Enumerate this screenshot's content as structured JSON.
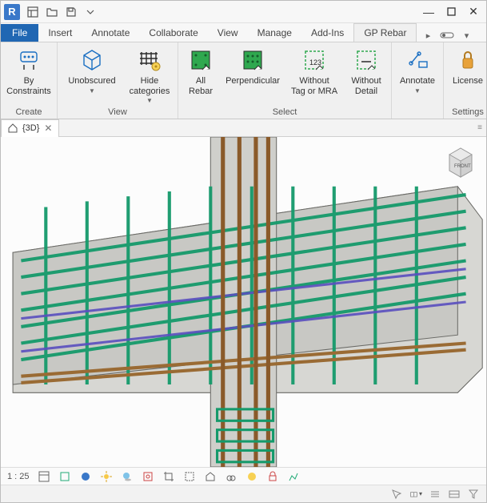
{
  "app": {
    "r_letter": "R"
  },
  "tabs": {
    "file": "File",
    "insert": "Insert",
    "annotate": "Annotate",
    "collaborate": "Collaborate",
    "view": "View",
    "manage": "Manage",
    "addins": "Add-Ins",
    "gprebar": "GP Rebar"
  },
  "ribbon": {
    "groups": {
      "create": "Create",
      "view": "View",
      "select": "Select",
      "settings": "Settings"
    },
    "btns": {
      "by_constraints": "By\nConstraints",
      "unobscured": "Unobscured",
      "hide_categories": "Hide\ncategories",
      "all_rebar": "All\nRebar",
      "perpendicular": "Perpendicular",
      "without_tag": "Without\nTag or MRA",
      "without_detail": "Without\nDetail",
      "annotate": "Annotate",
      "license": "License"
    }
  },
  "doc": {
    "view_name": "{3D}"
  },
  "scale": "1 : 25",
  "viewcube": {
    "face": "FRONT"
  }
}
